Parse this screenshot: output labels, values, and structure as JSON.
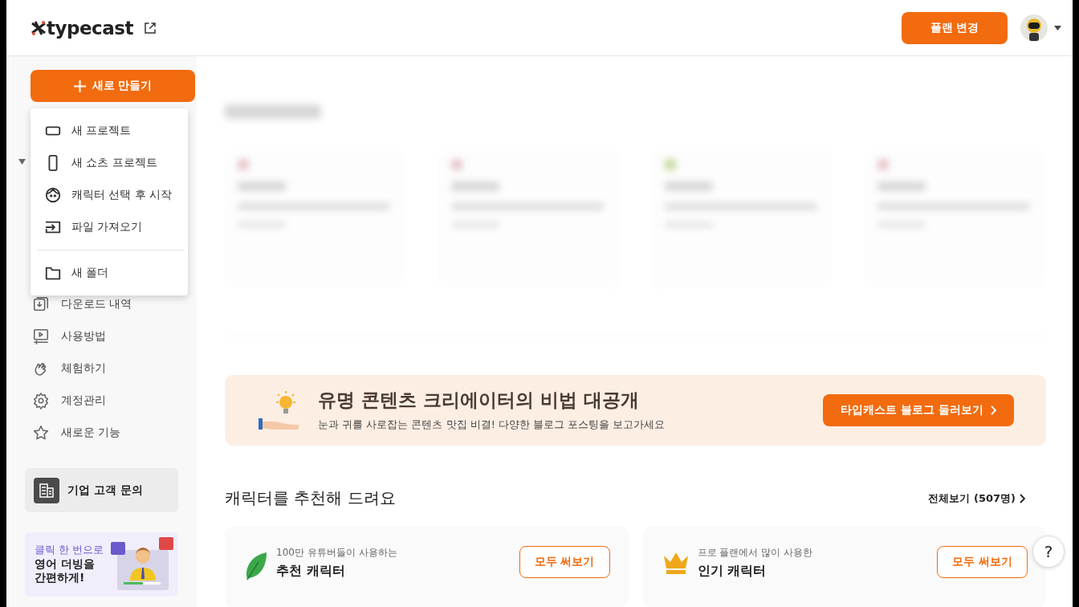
{
  "header": {
    "logo": "typecast",
    "plan_button": "플랜 변경"
  },
  "sidebar": {
    "create_button": "새로 만들기",
    "menu": [
      {
        "kind": "project",
        "label": "새 프로젝트"
      },
      {
        "kind": "shorts",
        "label": "새 쇼츠 프로젝트"
      },
      {
        "kind": "character",
        "label": "캐릭터 선택 후 시작"
      },
      {
        "kind": "import",
        "label": "파일 가져오기"
      },
      {
        "kind": "folder",
        "label": "새 폴더"
      }
    ],
    "items": [
      {
        "kind": "download",
        "label": "다운로드 내역"
      },
      {
        "kind": "howto",
        "label": "사용방법"
      },
      {
        "kind": "try",
        "label": "체험하기"
      },
      {
        "kind": "settings",
        "label": "계정관리"
      },
      {
        "kind": "new",
        "label": "새로운 기능"
      }
    ],
    "enterprise": "기업 고객 문의",
    "promo": {
      "line_1": "클릭 한 번으로",
      "line_2": "영어 더빙을",
      "line_3": "간편하게!"
    }
  },
  "banner": {
    "title": "유명 콘텐츠 크리에이터의 비법 대공개",
    "subtitle": "눈과 귀를 사로잡는 콘텐츠 맛집 비결! 다양한 블로그 포스팅을 보고가세요",
    "button": "타입캐스트 블로그 둘러보기"
  },
  "recommend": {
    "title": "캐릭터를 추천해 드려요",
    "view_all": "전체보기 (507명)",
    "cards": [
      {
        "kind": "leaf",
        "caption": "100만 유튜버들이 사용하는",
        "title": "추천 캐릭터",
        "button": "모두 써보기"
      },
      {
        "kind": "crown",
        "caption": "프로 플랜에서 많이 사용한",
        "title": "인기 캐릭터",
        "button": "모두 써보기"
      }
    ]
  },
  "help_button": "?"
}
